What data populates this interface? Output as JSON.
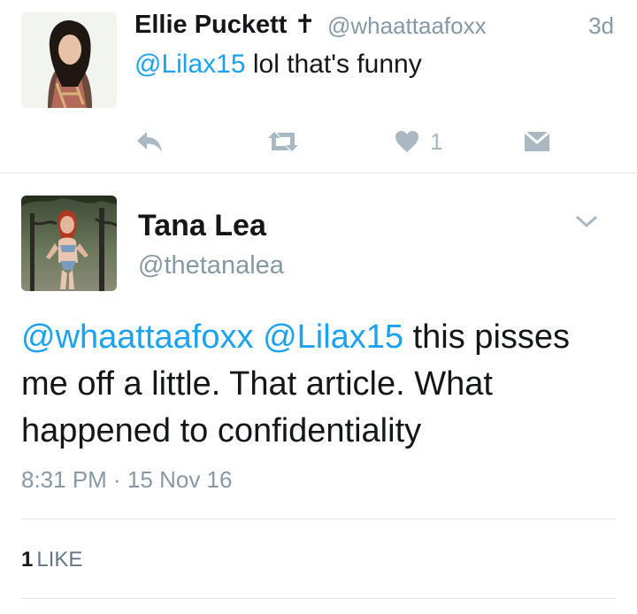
{
  "previous_tweet": {
    "author_name": "Ellie Puckett ✝",
    "handle": "@whaattaafoxx",
    "time_ago": "3d",
    "mention": "@Lilax15",
    "text": " lol that's funny",
    "like_count": "1",
    "icons": [
      "reply-icon",
      "retweet-icon",
      "heart-icon",
      "message-icon"
    ]
  },
  "main_tweet": {
    "author_name": "Tana Lea",
    "handle": "@thetanalea",
    "mention_1": "@whaattaafoxx",
    "mention_2": "@Lilax15",
    "text": " this pisses me off a little. That article. What happened to confidentiality",
    "timestamp": "8:31 PM · 15 Nov 16",
    "likes_count": "1",
    "likes_label": "LIKE"
  },
  "colors": {
    "link": "#1da1f2",
    "secondary_text": "#8899a6",
    "action_icon": "#aab8c2",
    "divider": "#e1e8ed"
  }
}
